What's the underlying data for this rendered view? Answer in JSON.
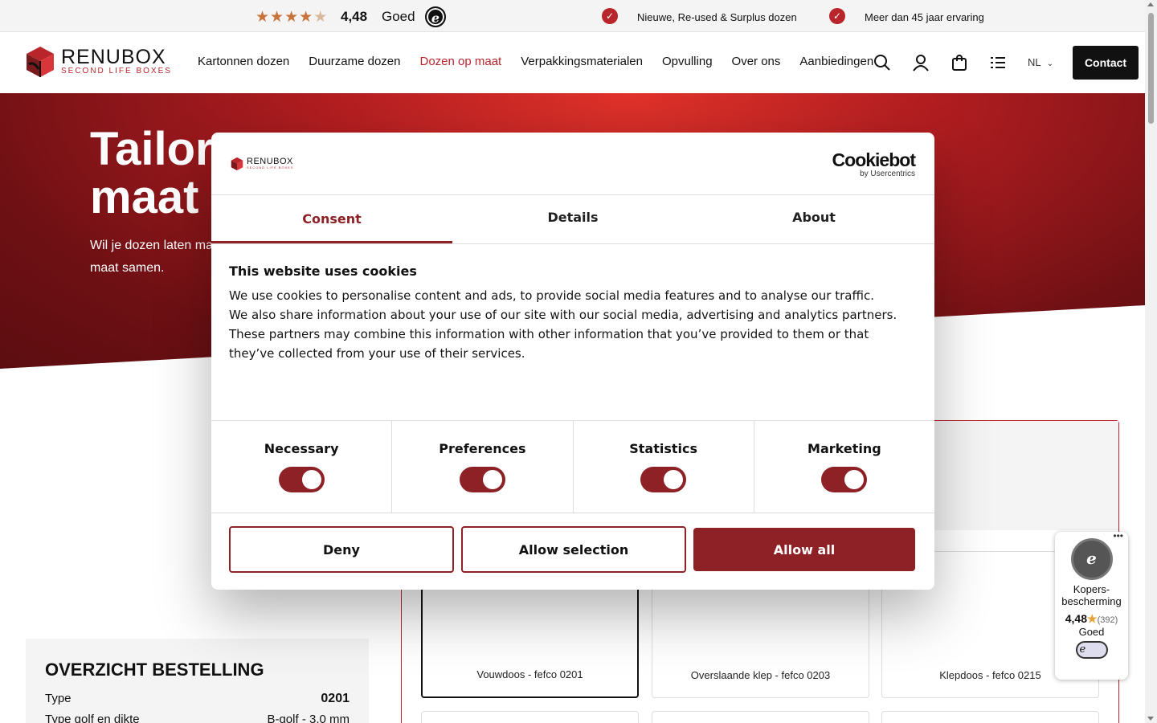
{
  "topbar": {
    "rating_value": "4,48",
    "rating_word": "Goed",
    "stars_full": 4,
    "usp": [
      "Nieuwe, Re-used & Surplus dozen",
      "Meer dan 45 jaar ervaring"
    ]
  },
  "header": {
    "logo_name": "RENUBOX",
    "logo_tagline": "SECOND LIFE BOXES",
    "nav": [
      "Kartonnen dozen",
      "Duurzame dozen",
      "Dozen op maat",
      "Verpakkingsmaterialen",
      "Opvulling",
      "Over ons",
      "Aanbiedingen"
    ],
    "active_nav": "Dozen op maat",
    "icons": [
      "search-icon",
      "account-icon",
      "cart-icon",
      "list-icon"
    ],
    "language": "NL",
    "contact_label": "Contact"
  },
  "hero": {
    "title_line1": "Tailor",
    "title_line2": "maat",
    "subtitle_line1": "Wil je dozen laten ma",
    "subtitle_line2": "maat samen."
  },
  "configurator": {
    "boxes": [
      "Vouwdoos - fefco 0201",
      "Overslaande klep - fefco 0203",
      "Klepdoos - fefco 0215"
    ],
    "selected_box": "Vouwdoos - fefco 0201"
  },
  "summary": {
    "title": "OVERZICHT BESTELLING",
    "rows": [
      {
        "label": "Type",
        "value": "0201"
      },
      {
        "label": "Type golf en dikte",
        "value": "B-golf - 3,0 mm"
      }
    ]
  },
  "trusted_shops": {
    "label": "Kopers-bescherming",
    "score": "4,48",
    "count": "(392)",
    "word": "Goed"
  },
  "cookie_dialog": {
    "logo_name": "RENUBOX",
    "logo_tagline": "SECOND LIFE BOXES",
    "provider": "Cookiebot",
    "provider_sub": "by Usercentrics",
    "tabs": [
      "Consent",
      "Details",
      "About"
    ],
    "active_tab": "Consent",
    "heading": "This website uses cookies",
    "paragraphs": [
      "We use cookies to personalise content and ads, to provide social media features and to analyse our traffic.",
      "We also share information about your use of our site with our social media, advertising and analytics partners.",
      "These partners may combine this information with other information that you’ve provided to them or that they’ve collected from your use of their services."
    ],
    "categories": [
      {
        "label": "Necessary",
        "checked": true
      },
      {
        "label": "Preferences",
        "checked": true
      },
      {
        "label": "Statistics",
        "checked": true
      },
      {
        "label": "Marketing",
        "checked": true
      }
    ],
    "buttons": {
      "deny": "Deny",
      "allow_selection": "Allow selection",
      "allow_all": "Allow all"
    },
    "accent_color": "#8e2125"
  }
}
